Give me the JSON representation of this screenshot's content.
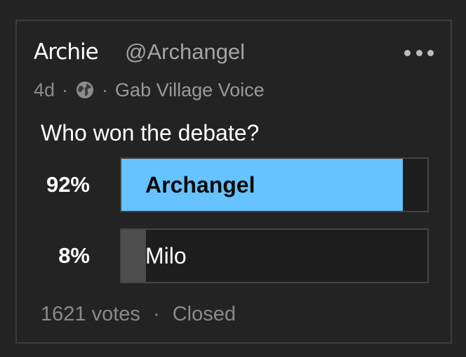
{
  "post": {
    "author_name": "Archie",
    "author_handle": "@Archangel",
    "age": "4d",
    "separator": "·",
    "visibility_icon": "globe-icon",
    "group_name": "Gab Village Voice",
    "menu_icon": "more-horizontal-icon"
  },
  "poll": {
    "question": "Who won the debate?",
    "options": [
      {
        "label": "Archangel",
        "percent_text": "92%",
        "percent": 92,
        "leading": true
      },
      {
        "label": "Milo",
        "percent_text": "8%",
        "percent": 8,
        "leading": false
      }
    ],
    "votes_text": "1621 votes",
    "status": "Closed"
  },
  "colors": {
    "background": "#242424",
    "leading_fill": "#67c3ff",
    "other_fill": "#4d4d4d",
    "muted_text": "#8c8c8c"
  }
}
